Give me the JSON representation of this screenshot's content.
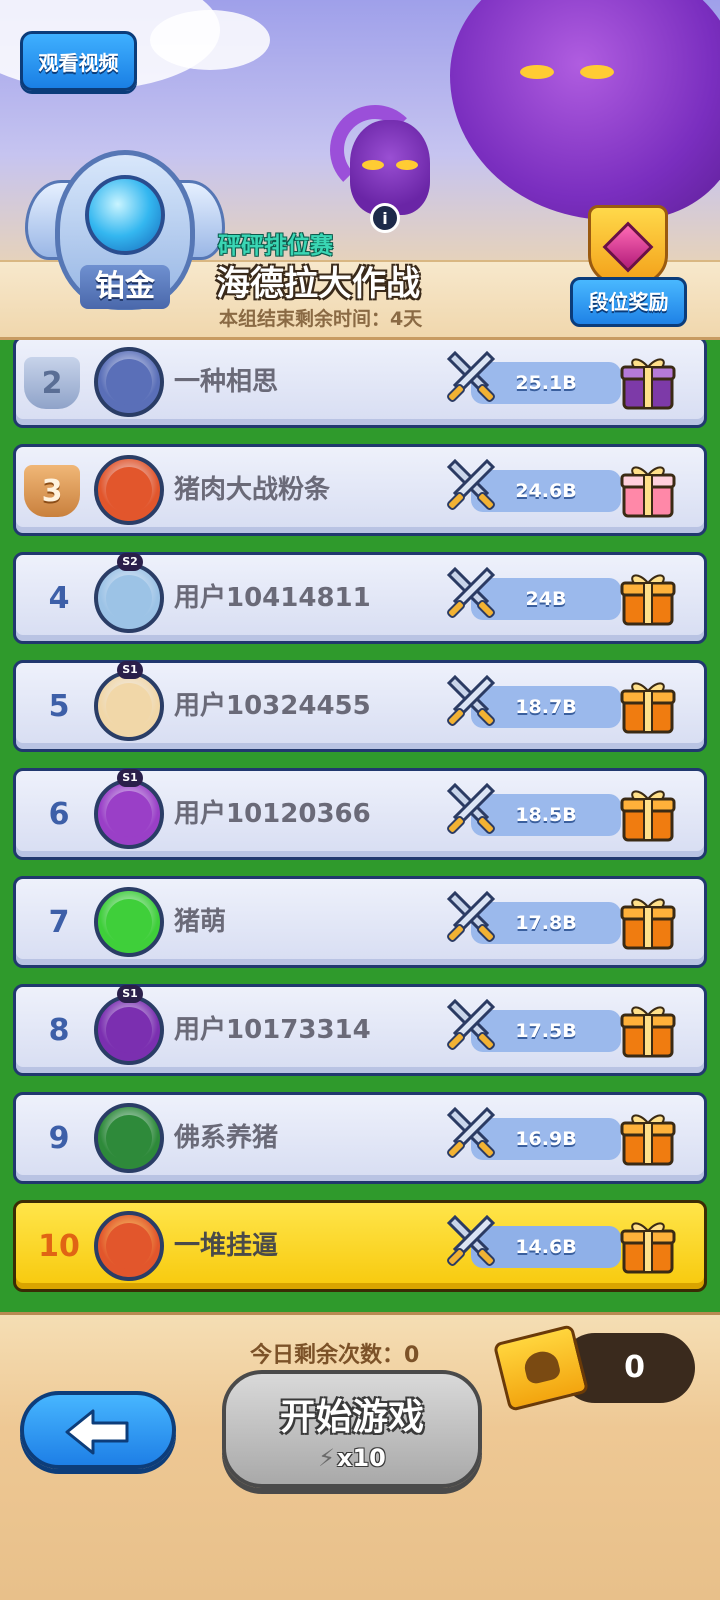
{
  "header": {
    "watch_video_label": "观看视频",
    "badge_rank": "铂金",
    "event_subtitle": "砰砰排位赛",
    "event_title": "海德拉大作战",
    "timer_text": "本组结束剩余时间：4天",
    "info_icon": "i",
    "reward_button_label": "段位奖励"
  },
  "leaderboard": {
    "rows": [
      {
        "rank": "2",
        "medal": "silver",
        "name": "一种相思",
        "score": "25.1B",
        "gift": "purple",
        "avatar_color": "#5a6fb8",
        "season": ""
      },
      {
        "rank": "3",
        "medal": "bronze",
        "name": "猪肉大战粉条",
        "score": "24.6B",
        "gift": "pink",
        "avatar_color": "#e2562c",
        "season": ""
      },
      {
        "rank": "4",
        "medal": "",
        "name": "用户10414811",
        "score": "24B",
        "gift": "orange",
        "avatar_color": "#9cc3e6",
        "season": "S2"
      },
      {
        "rank": "5",
        "medal": "",
        "name": "用户10324455",
        "score": "18.7B",
        "gift": "orange",
        "avatar_color": "#f1d7a8",
        "season": "S1"
      },
      {
        "rank": "6",
        "medal": "",
        "name": "用户10120366",
        "score": "18.5B",
        "gift": "orange",
        "avatar_color": "#9a3fc7",
        "season": "S1"
      },
      {
        "rank": "7",
        "medal": "",
        "name": "猪萌",
        "score": "17.8B",
        "gift": "orange",
        "avatar_color": "#3fcf3a",
        "season": ""
      },
      {
        "rank": "8",
        "medal": "",
        "name": "用户10173314",
        "score": "17.5B",
        "gift": "orange",
        "avatar_color": "#7b2fb0",
        "season": "S1"
      },
      {
        "rank": "9",
        "medal": "",
        "name": "佛系养猪",
        "score": "16.9B",
        "gift": "orange",
        "avatar_color": "#2e8a3a",
        "season": ""
      },
      {
        "rank": "10",
        "medal": "",
        "name": "一堆挂逼",
        "score": "14.6B",
        "gift": "orange",
        "avatar_color": "#e2562c",
        "season": "",
        "highlight": true
      }
    ]
  },
  "footer": {
    "remaining_text": "今日剩余次数：0",
    "ticket_count": "0",
    "start_label": "开始游戏",
    "cost_text": "x10",
    "back_icon": "arrow-left-icon"
  },
  "colors": {
    "board_green": "#2f9a2c",
    "row_blue_border": "#21386e",
    "highlight_yellow": "#f7c90c",
    "button_blue": "#1e7fe6"
  }
}
